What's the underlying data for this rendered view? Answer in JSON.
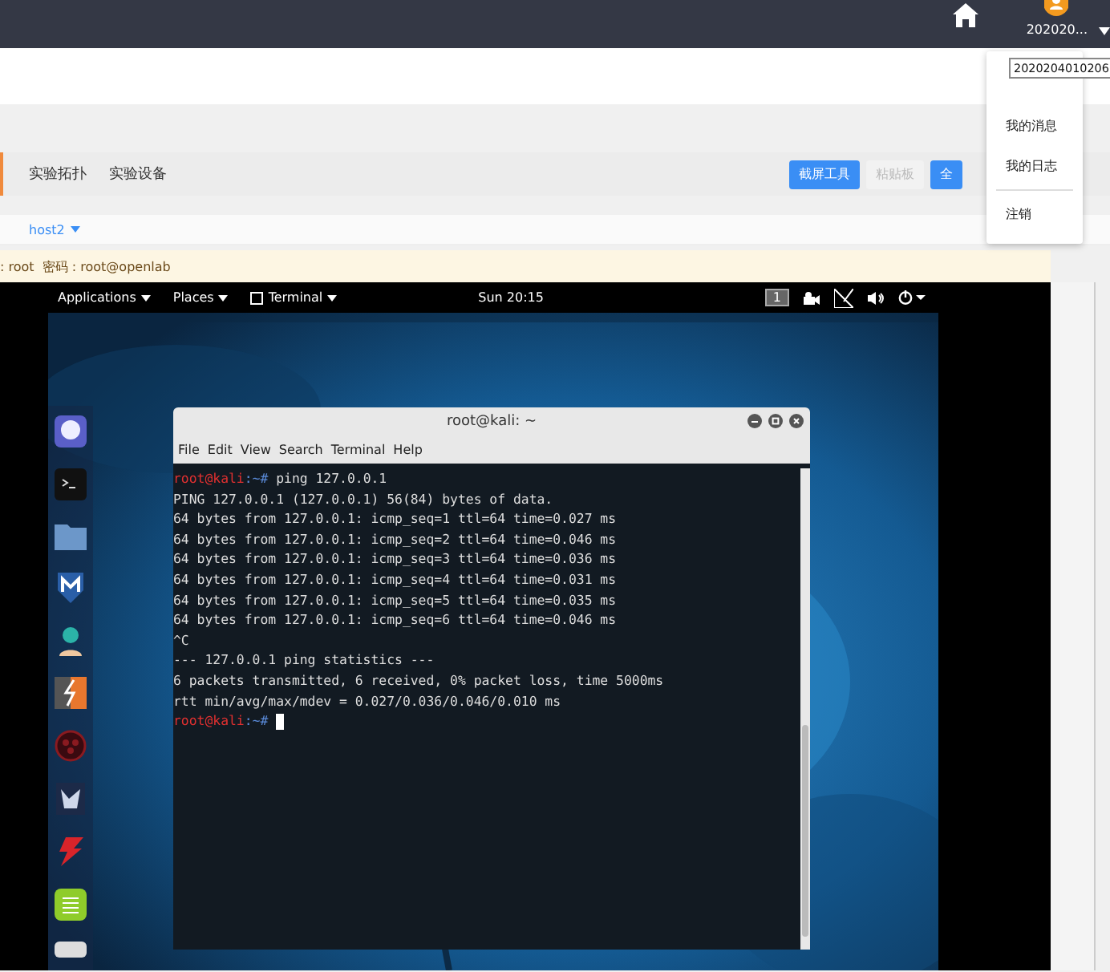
{
  "top_bar": {
    "user_label": "202020...",
    "user_tooltip": "2020204010206"
  },
  "user_menu": {
    "items": [
      {
        "label": "我的消息",
        "divider_before": false
      },
      {
        "label": "我的日志",
        "divider_before": false
      },
      {
        "label": "注销",
        "divider_before": true
      }
    ]
  },
  "tabs": [
    {
      "label": "实验拓扑"
    },
    {
      "label": "实验设备"
    }
  ],
  "toolbar_buttons": [
    {
      "label": "截屏工具",
      "disabled": false
    },
    {
      "label": "粘贴板",
      "disabled": true
    },
    {
      "label": "全",
      "disabled": false
    }
  ],
  "host_select": {
    "value": "host2"
  },
  "credentials": ": root  密码 : root@openlab",
  "vm": {
    "panel": {
      "menus": [
        "Applications",
        "Places",
        "Terminal"
      ],
      "clock": "Sun 20:15",
      "workspace": "1"
    },
    "terminal": {
      "title": "root@kali: ~",
      "menu": [
        "File",
        "Edit",
        "View",
        "Search",
        "Terminal",
        "Help"
      ],
      "lines": [
        {
          "kind": "prompt",
          "user": "root@kali",
          "path": ":~#",
          "text": " ping 127.0.0.1"
        },
        {
          "kind": "output",
          "text": "PING 127.0.0.1 (127.0.0.1) 56(84) bytes of data."
        },
        {
          "kind": "output",
          "text": "64 bytes from 127.0.0.1: icmp_seq=1 ttl=64 time=0.027 ms"
        },
        {
          "kind": "output",
          "text": "64 bytes from 127.0.0.1: icmp_seq=2 ttl=64 time=0.046 ms"
        },
        {
          "kind": "output",
          "text": "64 bytes from 127.0.0.1: icmp_seq=3 ttl=64 time=0.036 ms"
        },
        {
          "kind": "output",
          "text": "64 bytes from 127.0.0.1: icmp_seq=4 ttl=64 time=0.031 ms"
        },
        {
          "kind": "output",
          "text": "64 bytes from 127.0.0.1: icmp_seq=5 ttl=64 time=0.035 ms"
        },
        {
          "kind": "output",
          "text": "64 bytes from 127.0.0.1: icmp_seq=6 ttl=64 time=0.046 ms"
        },
        {
          "kind": "output",
          "text": "^C"
        },
        {
          "kind": "output",
          "text": "--- 127.0.0.1 ping statistics ---"
        },
        {
          "kind": "output",
          "text": "6 packets transmitted, 6 received, 0% packet loss, time 5000ms"
        },
        {
          "kind": "output",
          "text": "rtt min/avg/max/mdev = 0.027/0.036/0.046/0.010 ms"
        },
        {
          "kind": "prompt",
          "user": "root@kali",
          "path": ":~#"
        }
      ]
    }
  }
}
